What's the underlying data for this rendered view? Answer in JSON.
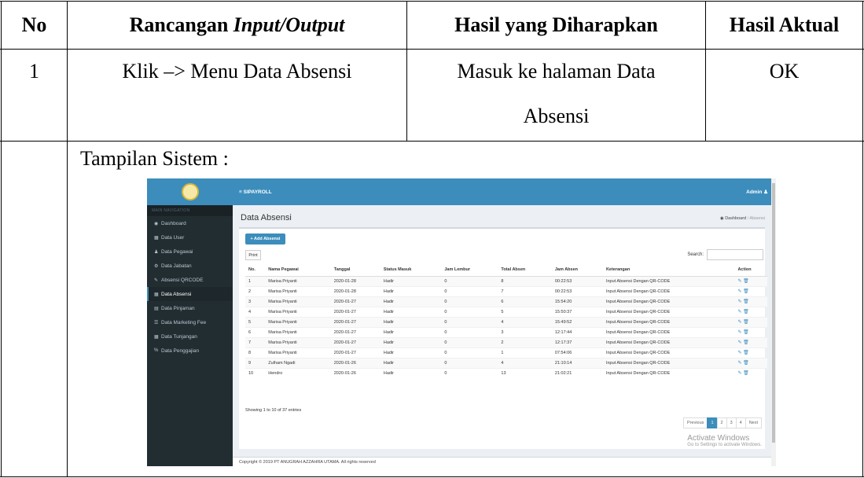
{
  "table_header": {
    "no": "No",
    "rancangan_prefix": "Rancangan ",
    "rancangan_italic": "Input/Output",
    "hasil_harapan": "Hasil yang Diharapkan",
    "hasil_aktual": "Hasil Aktual"
  },
  "row": {
    "no": "1",
    "input_output": "Klik –> Menu Data Absensi",
    "expected_line1": "Masuk ke halaman Data",
    "expected_line2": "Absensi",
    "actual": "OK"
  },
  "tampilan_label": "Tampilan Sistem :",
  "app": {
    "brand": "SIPAYROLL",
    "user": "Admin",
    "nav_header": "MAIN NAVIGATION",
    "sidebar": [
      {
        "label": "Dashboard",
        "icon": "dashboard-icon"
      },
      {
        "label": "Data User",
        "icon": "table-icon"
      },
      {
        "label": "Data Pegawai",
        "icon": "users-icon"
      },
      {
        "label": "Data Jabatan",
        "icon": "gear-icon"
      },
      {
        "label": "Absensi QRCODE",
        "icon": "pencil-icon"
      },
      {
        "label": "Data Absensi",
        "icon": "table-icon"
      },
      {
        "label": "Data Pinjaman",
        "icon": "grid-icon"
      },
      {
        "label": "Data Marketing Fee",
        "icon": "list-icon"
      },
      {
        "label": "Data Tunjangan",
        "icon": "table-icon"
      },
      {
        "label": "Data Penggajian",
        "icon": "percent-icon"
      }
    ],
    "page_title": "Data Absensi",
    "breadcrumb": {
      "home": "Dashboard",
      "current": "Absensi"
    },
    "add_button": "+ Add Absensi",
    "print_button": "Print",
    "search_label": "Search:",
    "columns": [
      "No.",
      "Nama Pegawai",
      "Tanggal",
      "Status Masuk",
      "Jam Lembur",
      "Total Absen",
      "Jam Absen",
      "Keterangan",
      "Action"
    ],
    "rows": [
      [
        "1",
        "Marisa Priyanti",
        "2020-01-28",
        "Hadir",
        "0",
        "8",
        "00:22:53",
        "Input Absensi Dengan QR-CODE"
      ],
      [
        "2",
        "Marisa Priyanti",
        "2020-01-28",
        "Hadir",
        "0",
        "7",
        "00:22:53",
        "Input Absensi Dengan QR-CODE"
      ],
      [
        "3",
        "Marisa Priyanti",
        "2020-01-27",
        "Hadir",
        "0",
        "6",
        "15:54:20",
        "Input Absensi Dengan QR-CODE"
      ],
      [
        "4",
        "Marisa Priyanti",
        "2020-01-27",
        "Hadir",
        "0",
        "5",
        "15:50:37",
        "Input Absensi Dengan QR-CODE"
      ],
      [
        "5",
        "Marisa Priyanti",
        "2020-01-27",
        "Hadir",
        "0",
        "4",
        "15:49:52",
        "Input Absensi Dengan QR-CODE"
      ],
      [
        "6",
        "Marisa Priyanti",
        "2020-01-27",
        "Hadir",
        "0",
        "3",
        "12:17:44",
        "Input Absensi Dengan QR-CODE"
      ],
      [
        "7",
        "Marisa Priyanti",
        "2020-01-27",
        "Hadir",
        "0",
        "2",
        "12:17:37",
        "Input Absensi Dengan QR-CODE"
      ],
      [
        "8",
        "Marisa Priyanti",
        "2020-01-27",
        "Hadir",
        "0",
        "1",
        "07:54:06",
        "Input Absensi Dengan QR-CODE"
      ],
      [
        "9",
        "Zulham Ngadi",
        "2020-01-26",
        "Hadir",
        "0",
        "4",
        "21:10:14",
        "Input Absensi Dengan QR-CODE"
      ],
      [
        "10",
        "Hendro",
        "2020-01-26",
        "Hadir",
        "0",
        "13",
        "21:02:21",
        "Input Absensi Dengan QR-CODE"
      ]
    ],
    "action_icons": "✎ 🗑",
    "info": "Showing 1 to 10 of 37 entries",
    "pager": {
      "prev": "Previous",
      "pages": [
        "1",
        "2",
        "3",
        "4"
      ],
      "next": "Next",
      "current": "1"
    },
    "activate_title": "Activate Windows",
    "activate_sub": "Go to Settings to activate Windows.",
    "footer": "Copyright © 2019 PT ANUGRAH AZZAHRA UTAMA. All rights reserved",
    "colors": {
      "primary": "#3c8dbc",
      "sidebar": "#222d32"
    }
  }
}
